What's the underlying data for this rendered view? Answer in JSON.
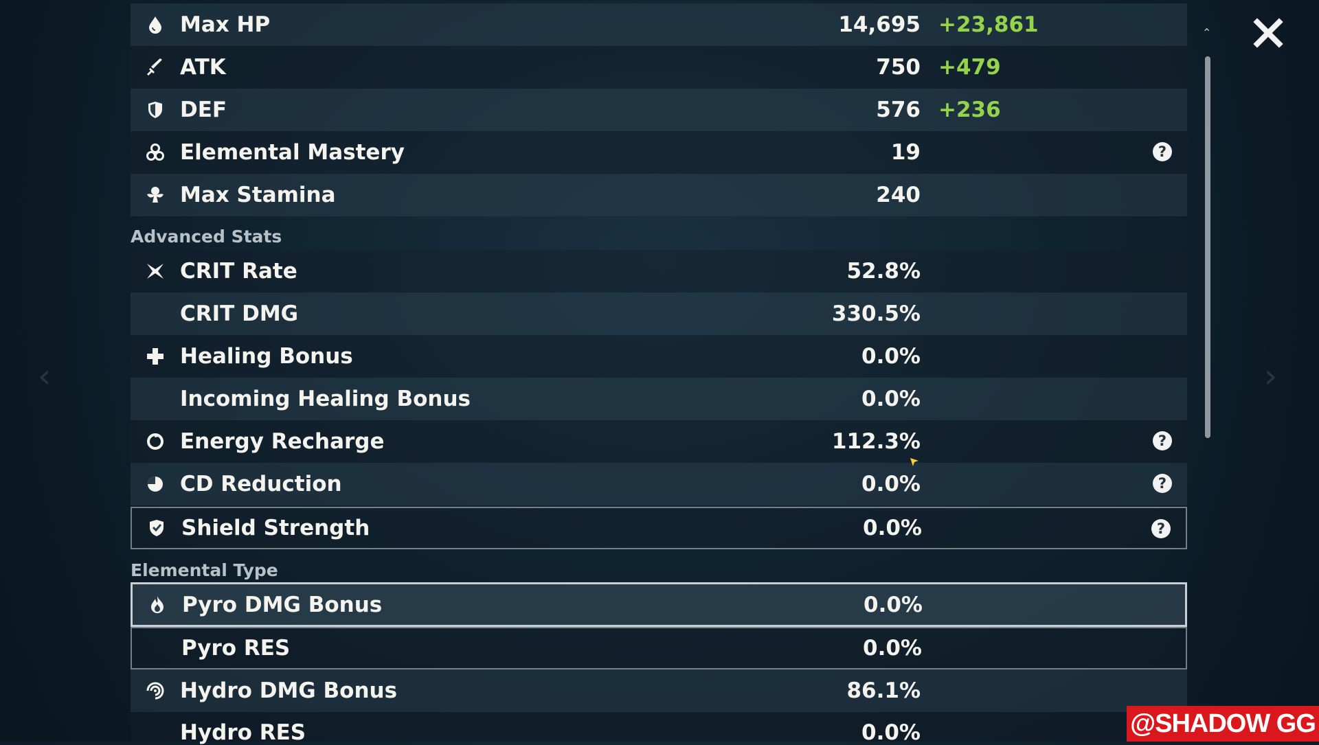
{
  "main_stats": [
    {
      "label": "Max HP",
      "value": "14,695",
      "bonus": "+23,861",
      "icon": "hp-drop-icon",
      "help": false
    },
    {
      "label": "ATK",
      "value": "750",
      "bonus": "+479",
      "icon": "sword-icon",
      "help": false
    },
    {
      "label": "DEF",
      "value": "576",
      "bonus": "+236",
      "icon": "shield-icon",
      "help": false
    },
    {
      "label": "Elemental Mastery",
      "value": "19",
      "bonus": "",
      "icon": "elemental-mastery-icon",
      "help": true
    },
    {
      "label": "Max Stamina",
      "value": "240",
      "bonus": "",
      "icon": "stamina-icon",
      "help": false
    }
  ],
  "advanced_title": "Advanced Stats",
  "advanced_stats": [
    {
      "label": "CRIT Rate",
      "value": "52.8%",
      "icon": "crit-star-icon",
      "help": false
    },
    {
      "label": "CRIT DMG",
      "value": "330.5%",
      "icon": "",
      "help": false
    },
    {
      "label": "Healing Bonus",
      "value": "0.0%",
      "icon": "healing-cross-icon",
      "help": false
    },
    {
      "label": "Incoming Healing Bonus",
      "value": "0.0%",
      "icon": "",
      "help": false
    },
    {
      "label": "Energy Recharge",
      "value": "112.3%",
      "icon": "energy-recharge-icon",
      "help": true
    },
    {
      "label": "CD Reduction",
      "value": "0.0%",
      "icon": "cd-reduction-icon",
      "help": true
    },
    {
      "label": "Shield Strength",
      "value": "0.0%",
      "icon": "shield-strength-icon",
      "help": true
    }
  ],
  "elemental_title": "Elemental Type",
  "elemental_stats": [
    {
      "label": "Pyro DMG Bonus",
      "value": "0.0%",
      "icon": "pyro-icon"
    },
    {
      "label": "Pyro RES",
      "value": "0.0%",
      "icon": ""
    },
    {
      "label": "Hydro DMG Bonus",
      "value": "86.1%",
      "icon": "hydro-icon"
    },
    {
      "label": "Hydro RES",
      "value": "0.0%",
      "icon": ""
    }
  ],
  "help_glyph": "?",
  "watermark": "@SHADOW GG",
  "colors": {
    "bonus": "#95d44a",
    "watermark_bg": "#d9171c"
  }
}
